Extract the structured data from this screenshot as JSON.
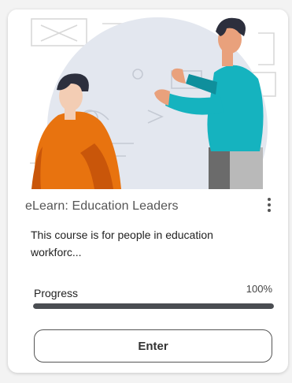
{
  "course": {
    "title": "eLearn: Education Leaders",
    "description": "This course is for people in education workforc...",
    "image_description": "two-people-collaborating-illustration"
  },
  "progress": {
    "label": "Progress",
    "value_text": "100%",
    "value": 1.0
  },
  "actions": {
    "enter_label": "Enter",
    "more_icon": "kebab-menu-icon"
  },
  "colors": {
    "card_bg": "#ffffff",
    "progress_fill": "#4a4d52",
    "teal_shirt": "#15b3bf",
    "orange_shirt": "#e8730f",
    "hero_circle": "#e3e7ef"
  }
}
